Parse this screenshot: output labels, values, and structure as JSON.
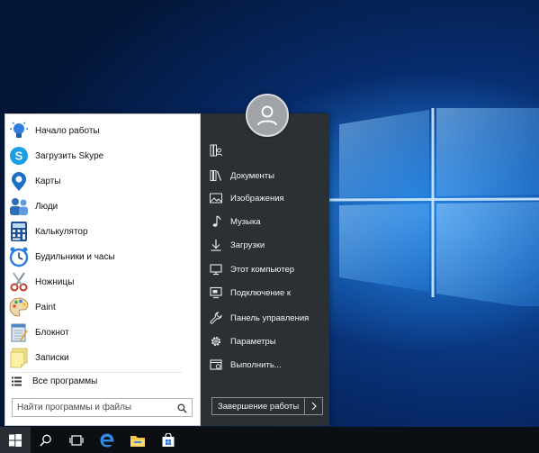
{
  "colors": {
    "accent": "#2f7fe0",
    "menu_dark": "#2b3035",
    "taskbar": "#0b0e12"
  },
  "start_menu": {
    "programs": [
      {
        "label": "Начало работы",
        "icon": "lightbulb-icon"
      },
      {
        "label": "Загрузить Skype",
        "icon": "skype-icon"
      },
      {
        "label": "Карты",
        "icon": "maps-icon"
      },
      {
        "label": "Люди",
        "icon": "people-icon"
      },
      {
        "label": "Калькулятор",
        "icon": "calculator-icon"
      },
      {
        "label": "Будильники и часы",
        "icon": "alarm-clock-icon"
      },
      {
        "label": "Ножницы",
        "icon": "scissors-icon"
      },
      {
        "label": "Paint",
        "icon": "paint-palette-icon"
      },
      {
        "label": "Блокнот",
        "icon": "notepad-icon"
      },
      {
        "label": "Записки",
        "icon": "sticky-notes-icon"
      }
    ],
    "all_programs": "Все программы",
    "search": {
      "placeholder": "Найти программы и файлы",
      "value": ""
    },
    "places": [
      {
        "label": "",
        "icon": "user-folder-icon"
      },
      {
        "label": "Документы",
        "icon": "library-icon"
      },
      {
        "label": "Изображения",
        "icon": "pictures-icon"
      },
      {
        "label": "Музыка",
        "icon": "music-note-icon"
      },
      {
        "label": "Загрузки",
        "icon": "download-icon"
      },
      {
        "label": "Этот компьютер",
        "icon": "computer-icon"
      },
      {
        "label": "Подключение к",
        "icon": "remote-connection-icon"
      },
      {
        "label": "Панель управления",
        "icon": "wrench-icon"
      },
      {
        "label": "Параметры",
        "icon": "gear-icon"
      },
      {
        "label": "Выполнить...",
        "icon": "run-icon"
      }
    ],
    "shutdown_label": "Завершение работы",
    "shutdown_arrow": "chevron-right-icon"
  },
  "taskbar": {
    "items": [
      "windows-start-icon",
      "search-icon",
      "task-view-icon",
      "edge-browser-icon",
      "file-explorer-icon",
      "store-icon"
    ]
  }
}
